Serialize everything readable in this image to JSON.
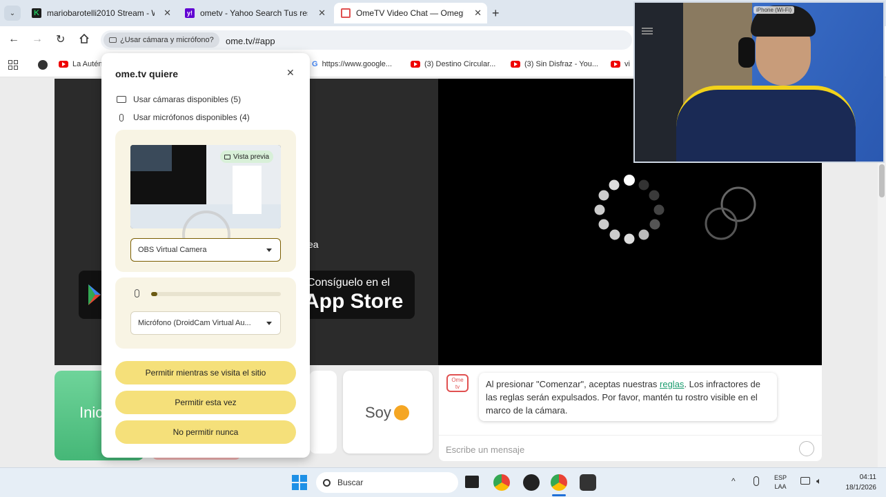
{
  "tabs": [
    {
      "label": "mariobarotelli2010 Stream - W...",
      "color": "#22c55e",
      "active": false
    },
    {
      "label": "ometv - Yahoo Search Tus resul...",
      "color": "#6001d2",
      "active": false
    },
    {
      "label": "OmeTV Video Chat — Omegle ...",
      "color": "#e05050",
      "active": true
    }
  ],
  "toolbar": {
    "permission_chip": "¿Usar cámara y micrófono?",
    "url": "ome.tv/#app"
  },
  "bookmarks": [
    {
      "label": "La Autén..."
    },
    {
      "label": "https://www.google..."
    },
    {
      "label": "(3) Destino Circular..."
    },
    {
      "label": "(3) Sin Disfraz - You..."
    },
    {
      "label": "vi"
    }
  ],
  "popup": {
    "title": "ome.tv quiere",
    "cameras": "Usar cámaras disponibles (5)",
    "mics": "Usar micrófonos disponibles (4)",
    "preview_badge": "Vista previa",
    "camera_select": "OBS Virtual Camera",
    "mic_select": "Micrófono (DroidCam Virtual Au...",
    "mic_level": 0.04,
    "btn_allow_site": "Permitir mientras se visita el sitio",
    "btn_allow_once": "Permitir esta vez",
    "btn_deny": "No permitir nunca"
  },
  "page": {
    "store_text_line1": "Consíguelo en el",
    "store_text_line2": "App Store",
    "partial_text": "ea",
    "start_button_partial": "Inic",
    "soy_label": "Soy",
    "logo_top": "Ome",
    "logo_bottom": "tv",
    "chat_message_pre": "Al presionar \"Comenzar\", aceptas nuestras ",
    "chat_link": "reglas",
    "chat_message_post": ". Los infractores de las reglas serán expulsados. Por favor, mantén tu rostro visible en el marco de la cámara.",
    "chat_placeholder": "Escribe un mensaje"
  },
  "cam_overlay": {
    "label": "iPhone (Wi-Fi)"
  },
  "taskbar": {
    "search": "Buscar",
    "lang_top": "ESP",
    "lang_bottom": "LAA",
    "time": "04:11",
    "date": "18/1/2026"
  },
  "colors": {
    "accent_yellow": "#f5e07a",
    "green_start": "#5cc98a",
    "link": "#1a9c6e"
  }
}
